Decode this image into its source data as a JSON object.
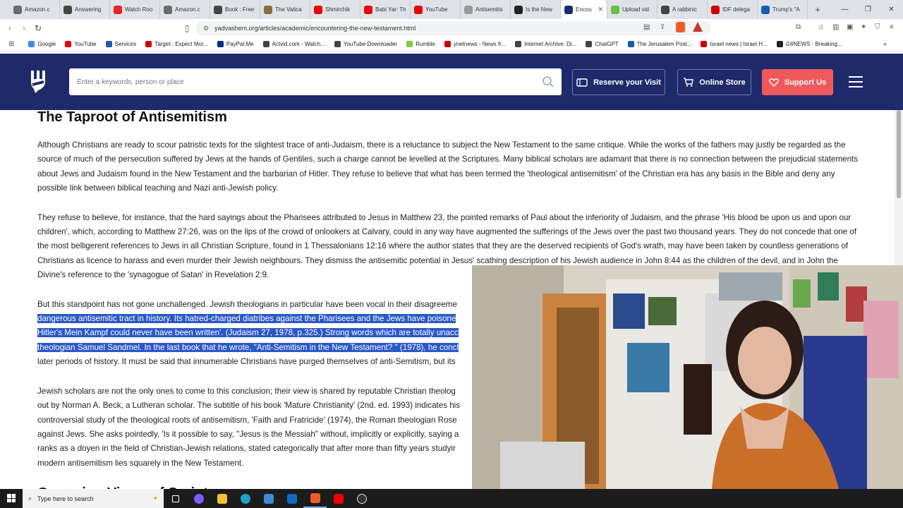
{
  "browser": {
    "tabs": [
      {
        "label": "Amazon.c",
        "color": "#6b6b6b"
      },
      {
        "label": "Answering",
        "color": "#444"
      },
      {
        "label": "Watch Roo",
        "color": "#e22"
      },
      {
        "label": "Amazon.c",
        "color": "#6b6b6b"
      },
      {
        "label": "Book : Free",
        "color": "#444"
      },
      {
        "label": "The Vatica",
        "color": "#8a6d3b"
      },
      {
        "label": "Shmirchik",
        "color": "#e00"
      },
      {
        "label": "Babi Yar: Th",
        "color": "#e00"
      },
      {
        "label": "YouTube",
        "color": "#e00"
      },
      {
        "label": "Antisemitis",
        "color": "#999"
      },
      {
        "label": "Is the New",
        "color": "#222"
      },
      {
        "label": "Encou",
        "color": "#1f2a6b"
      },
      {
        "label": "Upload vid",
        "color": "#6bbf3f"
      },
      {
        "label": "A rabbinic",
        "color": "#444"
      },
      {
        "label": "IDF delega",
        "color": "#c00"
      },
      {
        "label": "Trump's \"A",
        "color": "#1e5ab0"
      }
    ],
    "active_tab_index": 11,
    "close_label": "✕",
    "new_tab_label": "+",
    "url": "yadvashem.org/articles/academic/encountering-the-new-testament.html",
    "bookmarks": [
      {
        "label": "Google",
        "color": "#4285f4"
      },
      {
        "label": "YouTube",
        "color": "#e00"
      },
      {
        "label": "Services",
        "color": "#1e5ab0"
      },
      {
        "label": "Target : Expect Mor...",
        "color": "#c00"
      },
      {
        "label": "PayPal.Me",
        "color": "#003087"
      },
      {
        "label": "Actvid.com - Watch...",
        "color": "#444"
      },
      {
        "label": "YouTube Downloader",
        "color": "#444"
      },
      {
        "label": "Rumble",
        "color": "#85c742"
      },
      {
        "label": "ynetnews - News fr...",
        "color": "#c00"
      },
      {
        "label": "Internet Archive: Di...",
        "color": "#444"
      },
      {
        "label": "ChatGPT",
        "color": "#444"
      },
      {
        "label": "The Jerusalem Post...",
        "color": "#1e5ab0"
      },
      {
        "label": "Israel news | Israel H...",
        "color": "#c00"
      },
      {
        "label": "i24NEWS - Breaking...",
        "color": "#222"
      }
    ]
  },
  "site": {
    "search_placeholder": "Enter a keywords, person or place",
    "reserve_label": "Reserve your Visit",
    "store_label": "Online Store",
    "support_label": "Support Us",
    "header_color": "#1f2a6b",
    "support_color": "#f0595b"
  },
  "article": {
    "heading": "The Taproot of Antisemitism",
    "p1": "Although Christians are ready to scour patristic texts for the slightest trace of anti-Judaism, there is a reluctance to subject the New Testament to the same critique. While the works of the fathers may justly be regarded as the source of much of the persecution suffered by Jews at the hands of Gentiles, such a charge cannot be levelled at the Scriptures. Many biblical scholars are adamant that there is no connection between the prejudicial statements about Jews and Judaism found in the New Testament and the barbarian of Hitler. They refuse to believe that what has been termed the 'theological antisemitism' of the Christian era has any basis in the Bible and deny any possible link between biblical teaching and Nazi anti-Jewish policy.",
    "p2": "They refuse to believe, for instance, that the hard sayings about the Pharisees attributed to Jesus in Matthew 23, the pointed remarks of Paul about the inferiority of Judaism, and the phrase 'His blood be upon us and upon our children', which, according to Matthew 27:26, was on the lips of the crowd of onlookers at Calvary, could in any way have augmented the sufferings of the Jews over the past two thousand years. They do not concede that one of the most belligerent references to Jews in all Christian Scripture, found in 1 Thessalonians 12:16 where the author states that they are the deserved recipients of God's wrath, may have been taken by countless generations of Christians as licence to harass and even murder their Jewish neighbours. They dismiss the antisemitic potential in Jesus' scathing description of his Jewish audience in John 8:44 as the children of the devil, and in John the Divine's reference to the 'synagogue of Satan' in Revelation 2:9.",
    "p3_start": "But this standpoint has not gone unchallenged. Jewish theologians in particular have been vocal in their disagreeme",
    "p3_hl1": "dangerous antisemitic tract in history. Its hatred-charged diatribes against the Pharisees and the Jews have poisone",
    "p3_hl2": "Hitler's Mein Kampf could never have been written'. (Judaism 27, 1978, p.325.) Strong words which are totally unacc",
    "p3_hl3": "theologian Samuel Sandmel. In the last book that he wrote, \"Anti-Semitism in the New Testament? \" (1978), he concl",
    "p3_end": "later periods of history. It must be said that innumerable Christians have purged themselves of anti-Semitism, but its",
    "p4_l1": "Jewish scholars are not the only ones to come to this conclusion; their view is shared by reputable Christian theolog",
    "p4_l2": "out by Norman A. Beck, a Lutheran scholar. The subtitle of his book 'Mature Christianity' (2nd. ed. 1993) indicates his",
    "p4_l3": "controversial study of the theological roots of antisemitism, 'Faith and Fratricide' (1974), the Roman theologian Rose",
    "p4_l4": "against Jews. She asks pointedly, 'Is it possible to say, \"Jesus is the Messiah\" without, implicitly or explicitly, saying a",
    "p4_l5": "ranks as a doyen in the field of Christian-Jewish relations, stated categorically that after more than fifty years studyir",
    "p4_l6": "modern antisemitism lies squarely in the New Testament.",
    "next_heading": "Opposing Views of Scripture"
  },
  "taskbar": {
    "search_placeholder": "Type here to search"
  }
}
